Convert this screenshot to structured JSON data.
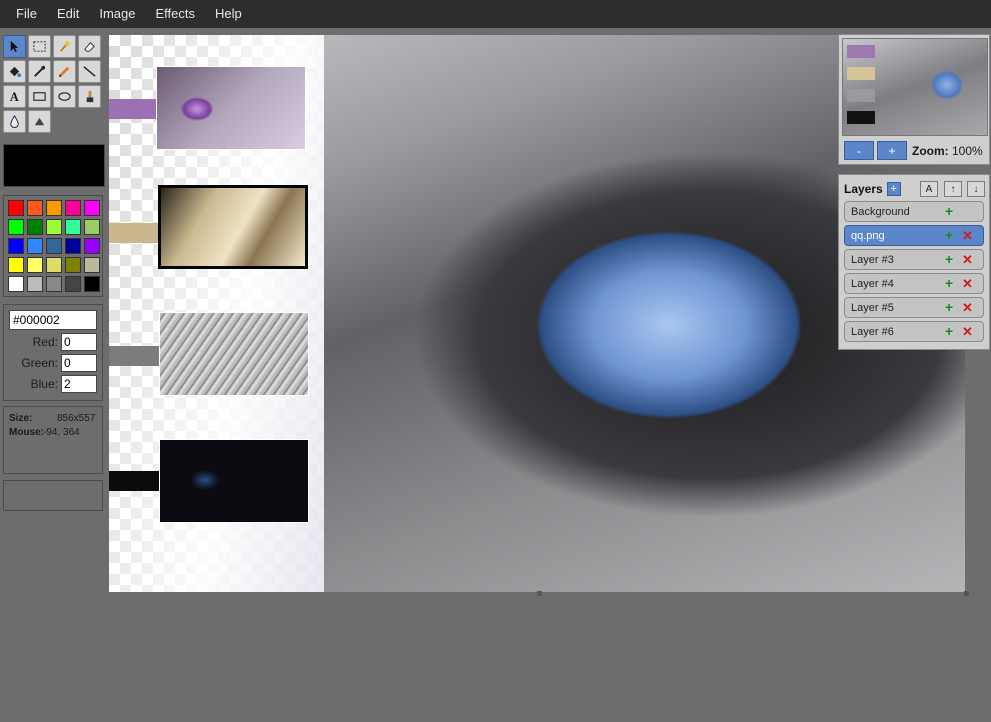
{
  "menu": [
    "File",
    "Edit",
    "Image",
    "Effects",
    "Help"
  ],
  "tools": [
    {
      "name": "select-tool",
      "icon": "arrow-cursor-icon",
      "active": true
    },
    {
      "name": "rect-select-tool",
      "icon": "marquee-icon"
    },
    {
      "name": "magic-wand-tool",
      "icon": "magic-wand-icon"
    },
    {
      "name": "eraser-tool",
      "icon": "eraser-icon"
    },
    {
      "name": "fill-tool",
      "icon": "paint-bucket-icon"
    },
    {
      "name": "color-picker-tool",
      "icon": "eyedropper-icon"
    },
    {
      "name": "pencil-tool",
      "icon": "pencil-icon"
    },
    {
      "name": "line-tool",
      "icon": "line-icon"
    },
    {
      "name": "text-tool",
      "icon": "text-icon"
    },
    {
      "name": "rectangle-tool",
      "icon": "rectangle-icon"
    },
    {
      "name": "ellipse-tool",
      "icon": "ellipse-icon"
    },
    {
      "name": "brush-tool",
      "icon": "brush-icon"
    },
    {
      "name": "blur-tool",
      "icon": "water-drop-icon"
    },
    {
      "name": "sharpen-tool",
      "icon": "triangle-icon"
    }
  ],
  "current_color": "#000002",
  "palette": [
    "#ff0000",
    "#ff5a1e",
    "#ff9900",
    "#ff0099",
    "#ff00ff",
    "#00ff00",
    "#008000",
    "#99ff33",
    "#33ff99",
    "#99cc66",
    "#0000ff",
    "#3388ff",
    "#336699",
    "#000099",
    "#9900ff",
    "#ffff00",
    "#ffff66",
    "#dddd66",
    "#808000",
    "#bbb99a",
    "#ffffff",
    "#bbbbbb",
    "#888888",
    "#444444",
    "#000000"
  ],
  "color_panel": {
    "hex": "#000002",
    "red_label": "Red:",
    "red": "0",
    "green_label": "Green:",
    "green": "0",
    "blue_label": "Blue:",
    "blue": "2"
  },
  "info": {
    "size_label": "Size:",
    "size": "856x557",
    "mouse_label": "Mouse:",
    "mouse": "-94, 364"
  },
  "navigator": {
    "minus": "-",
    "plus": "+",
    "zoom_label": "Zoom:",
    "zoom_value": "100%"
  },
  "layers": {
    "title": "Layers",
    "add": "+",
    "btn_a": "A",
    "btn_up": "↑",
    "btn_down": "↓",
    "items": [
      {
        "label": "Background",
        "selected": false,
        "deletable": false
      },
      {
        "label": "qq.png",
        "selected": true,
        "deletable": true
      },
      {
        "label": "Layer #3",
        "selected": false,
        "deletable": true
      },
      {
        "label": "Layer #4",
        "selected": false,
        "deletable": true
      },
      {
        "label": "Layer #5",
        "selected": false,
        "deletable": true
      },
      {
        "label": "Layer #6",
        "selected": false,
        "deletable": true
      }
    ],
    "plus_glyph": "+",
    "x_glyph": "✕"
  },
  "colors": {
    "accent": "#5b86c9",
    "menubar": "#2d2d2d",
    "background": "#6d6d6d",
    "panel": "#cfcfcf"
  }
}
